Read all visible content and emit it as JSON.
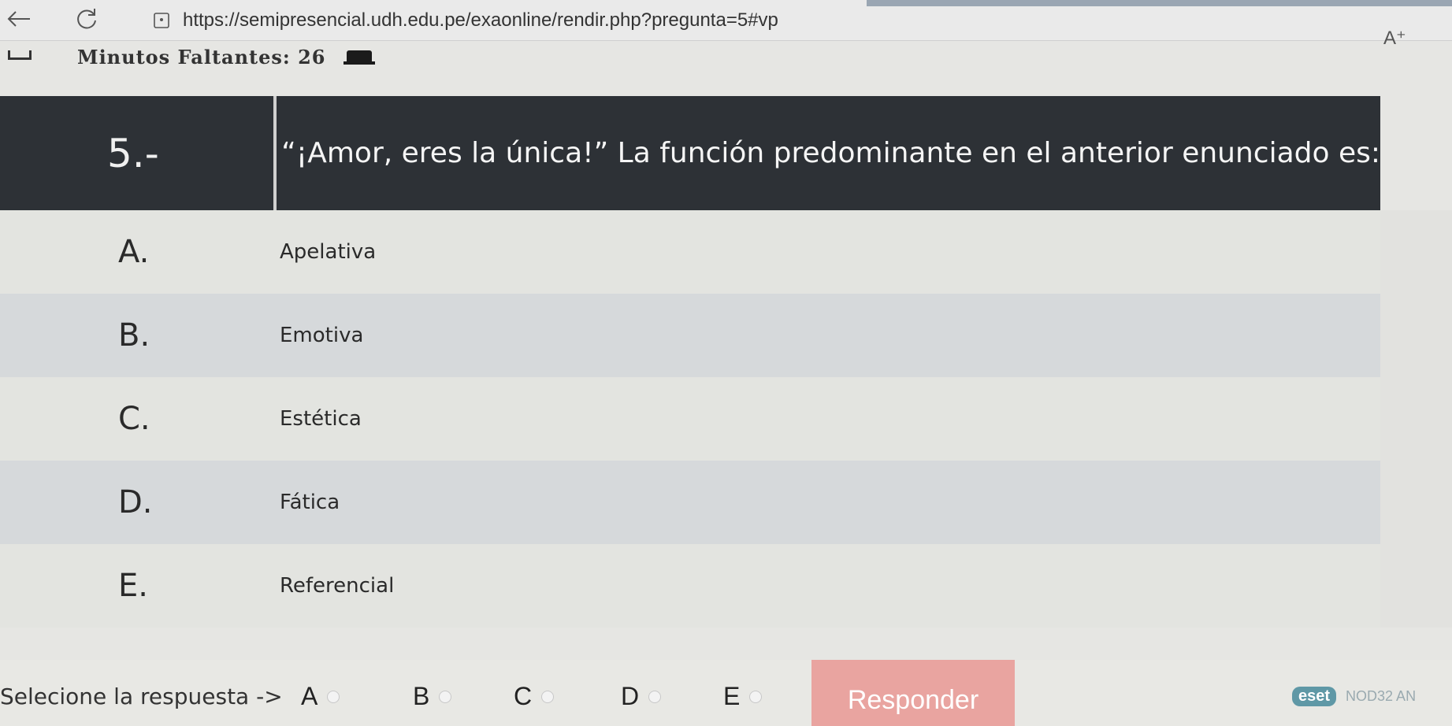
{
  "browser": {
    "url": "https://semipresencial.udh.edu.pe/exaonline/rendir.php?pregunta=5#vp",
    "reader_label": "A⁺"
  },
  "timer": {
    "text": "Minutos Faltantes: 26"
  },
  "question": {
    "number": "5.-",
    "text": "“¡Amor, eres la única!” La función predominante en el anterior enunciado es:"
  },
  "options": [
    {
      "letter": "A.",
      "text": "Apelativa"
    },
    {
      "letter": "B.",
      "text": "Emotiva"
    },
    {
      "letter": "C.",
      "text": "Estética"
    },
    {
      "letter": "D.",
      "text": "Fática"
    },
    {
      "letter": "E.",
      "text": "Referencial"
    }
  ],
  "answer": {
    "label": "Selecione la respuesta ->",
    "choices": [
      "A",
      "B",
      "C",
      "D",
      "E"
    ],
    "submit_label": "Responder"
  },
  "tray": {
    "logo_text": "eset",
    "product_text": "NOD32 AN"
  },
  "colors": {
    "header_bg": "#2d3136",
    "submit_bg": "#e9a4a0",
    "row_light": "#e3e4e0",
    "row_dark": "#d6d9db"
  },
  "icons": [
    "back-arrow-icon",
    "reload-icon",
    "lock-icon",
    "reader-view-icon",
    "sidebar-icon",
    "laptop-icon"
  ]
}
